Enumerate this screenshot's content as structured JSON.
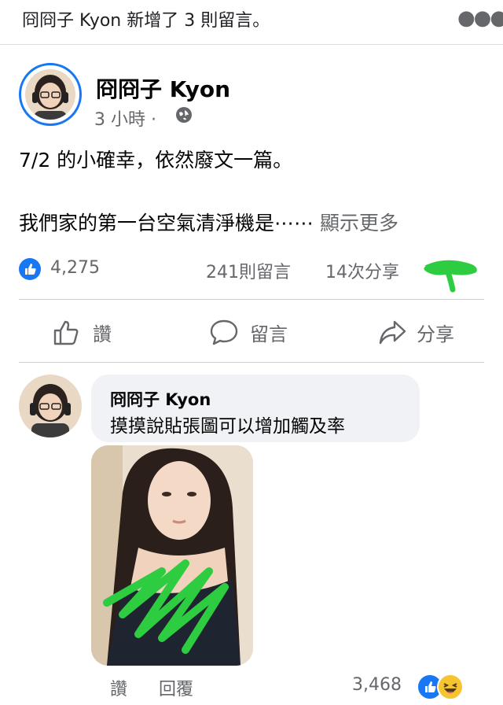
{
  "notification": {
    "text": "冏冏子 Kyon 新增了 3 則留言。",
    "more_icon": "more-dots-icon"
  },
  "post": {
    "author": "冏冏子 Kyon",
    "time": "3 小時 ·",
    "privacy_icon": "globe-icon",
    "line1": "7/2 的小確幸，依然廢文一篇。",
    "line2": "我們家的第一台空氣清淨機是⋯⋯",
    "see_more": "顯示更多"
  },
  "stats": {
    "likes": "4,275",
    "comments": "241則留言",
    "shares": "14次分享"
  },
  "actions": {
    "like": "讚",
    "comment": "留言",
    "share": "分享"
  },
  "comment": {
    "author": "冏冏子 Kyon",
    "text": "摸摸說貼張圖可以增加觸及率",
    "like": "讚",
    "reply": "回覆",
    "reaction_count": "3,468"
  },
  "colors": {
    "brand_blue": "#1877f2",
    "scribble_green": "#2ecc40",
    "muted": "#65676b"
  }
}
